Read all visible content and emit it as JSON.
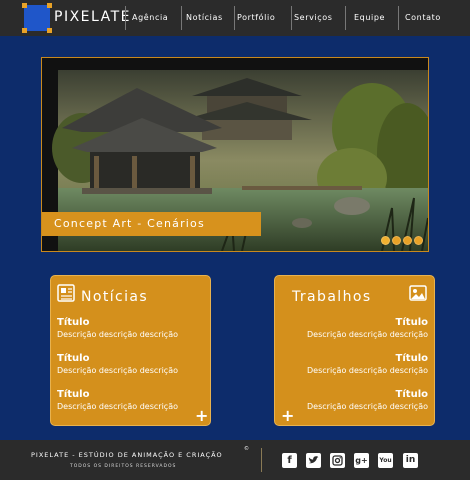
{
  "brand": {
    "name": "PIXELATE"
  },
  "nav": {
    "items": [
      {
        "label": "Agência"
      },
      {
        "label": "Notícias"
      },
      {
        "label": "Portfólio"
      },
      {
        "label": "Serviços"
      },
      {
        "label": "Equipe"
      },
      {
        "label": "Contato"
      }
    ]
  },
  "hero": {
    "caption": "Concept Art - Cenários",
    "slides": 4,
    "active_slide": 1
  },
  "news": {
    "title": "Notícias",
    "entries": [
      {
        "title": "Título",
        "desc": "Descrição descrição descrição"
      },
      {
        "title": "Título",
        "desc": "Descrição descrição descrição"
      },
      {
        "title": "Título",
        "desc": "Descrição descrição descrição"
      }
    ],
    "more": "+"
  },
  "works": {
    "title": "Trabalhos",
    "entries": [
      {
        "title": "Título",
        "desc": "Descrição descrição descrição"
      },
      {
        "title": "Título",
        "desc": "Descrição descrição descrição"
      },
      {
        "title": "Título",
        "desc": "Descrição descrição descrição"
      }
    ],
    "more": "+"
  },
  "footer": {
    "line1": "PIXELATE - ESTÚDIO DE ANIMAÇÃO E CRIAÇÃO",
    "copyright_mark": "©",
    "line2": "TODOS OS DIREITOS RESERVADOS",
    "social": [
      "facebook-icon",
      "twitter-icon",
      "instagram-icon",
      "google-plus-icon",
      "youtube-icon",
      "linkedin-icon"
    ]
  },
  "colors": {
    "background": "#0d2c6b",
    "bar": "#2b2b2b",
    "accent": "#d4901c",
    "logo_blue": "#1f56c9"
  }
}
